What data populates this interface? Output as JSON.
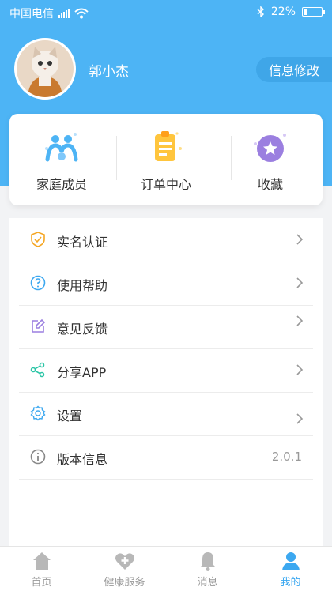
{
  "status_bar": {
    "carrier": "中国电信",
    "battery": "22%",
    "battery_level": 0.22
  },
  "profile": {
    "name": "郭小杰",
    "edit_label": "信息修改"
  },
  "quick_actions": [
    {
      "label": "家庭成员",
      "icon": "family-icon"
    },
    {
      "label": "订单中心",
      "icon": "order-clipboard-icon"
    },
    {
      "label": "收藏",
      "icon": "star-favorite-icon"
    }
  ],
  "menu": [
    {
      "label": "实名认证",
      "icon": "shield-check-icon",
      "value": ""
    },
    {
      "label": "使用帮助",
      "icon": "question-circle-icon",
      "value": ""
    },
    {
      "label": "意见反馈",
      "icon": "edit-feedback-icon",
      "value": ""
    },
    {
      "label": "分享APP",
      "icon": "share-icon",
      "value": ""
    },
    {
      "label": "设置",
      "icon": "settings-gear-icon",
      "value": ""
    },
    {
      "label": "版本信息",
      "icon": "info-circle-icon",
      "value": "2.0.1"
    }
  ],
  "tabbar": [
    {
      "label": "首页",
      "icon": "home-icon",
      "active": false
    },
    {
      "label": "健康服务",
      "icon": "health-heart-icon",
      "active": false
    },
    {
      "label": "消息",
      "icon": "bell-icon",
      "active": false
    },
    {
      "label": "我的",
      "icon": "user-profile-icon",
      "active": true
    }
  ],
  "colors": {
    "primary": "#4db4f5",
    "active_tab": "#3ca8f0"
  }
}
